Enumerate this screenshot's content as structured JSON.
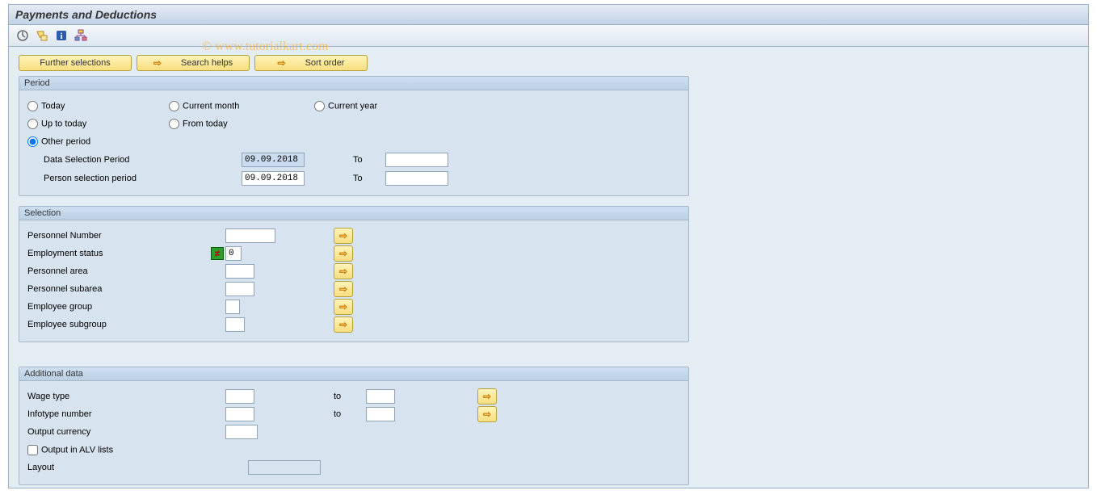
{
  "watermark": "© www.tutorialkart.com",
  "title": "Payments and Deductions",
  "buttons": {
    "further_selections": "Further selections",
    "search_helps": "Search helps",
    "sort_order": "Sort order"
  },
  "period": {
    "legend": "Period",
    "today": "Today",
    "current_month": "Current month",
    "current_year": "Current year",
    "up_to_today": "Up to today",
    "from_today": "From today",
    "other_period": "Other period",
    "data_sel_label": "Data Selection Period",
    "data_sel_from": "09.09.2018",
    "data_sel_to_label": "To",
    "data_sel_to": "",
    "person_sel_label": "Person selection period",
    "person_sel_from": "09.09.2018",
    "person_sel_to_label": "To",
    "person_sel_to": "",
    "selected": "other_period"
  },
  "selection": {
    "legend": "Selection",
    "personnel_number": {
      "label": "Personnel Number",
      "value": ""
    },
    "employment_status": {
      "label": "Employment status",
      "value": "0",
      "has_variant": true
    },
    "personnel_area": {
      "label": "Personnel area",
      "value": ""
    },
    "personnel_subarea": {
      "label": "Personnel subarea",
      "value": ""
    },
    "employee_group": {
      "label": "Employee group",
      "value": ""
    },
    "employee_subgroup": {
      "label": "Employee subgroup",
      "value": ""
    }
  },
  "additional": {
    "legend": "Additional data",
    "wage_type": {
      "label": "Wage type",
      "from": "",
      "to_label": "to",
      "to": ""
    },
    "infotype_number": {
      "label": "Infotype number",
      "from": "",
      "to_label": "to",
      "to": ""
    },
    "output_currency": {
      "label": "Output currency",
      "value": ""
    },
    "output_alv": {
      "label": "Output in ALV lists",
      "checked": false
    },
    "layout": {
      "label": "Layout",
      "value": ""
    }
  },
  "icons": {
    "arrow": "➨"
  }
}
